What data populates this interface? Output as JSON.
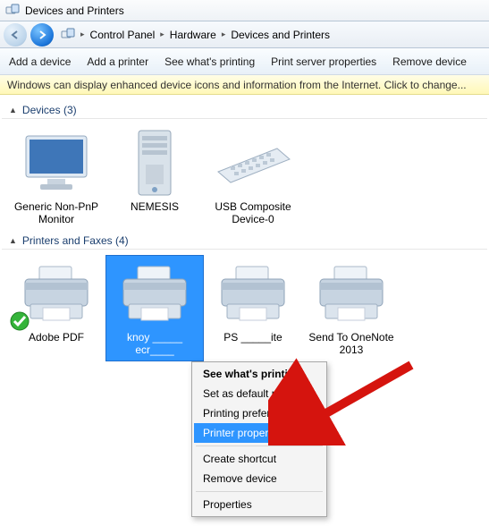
{
  "window": {
    "title": "Devices and Printers"
  },
  "breadcrumb": {
    "root_icon": "devices-printers-icon",
    "items": [
      "Control Panel",
      "Hardware",
      "Devices and Printers"
    ]
  },
  "toolbar": {
    "add_device": "Add a device",
    "add_printer": "Add a printer",
    "see_printing": "See what's printing",
    "server_props": "Print server properties",
    "remove_device": "Remove device"
  },
  "infoband": {
    "text": "Windows can display enhanced device icons and information from the Internet. Click to change..."
  },
  "sections": {
    "devices": {
      "label": "Devices",
      "count": 3,
      "items": [
        {
          "label": "Generic Non-PnP Monitor",
          "icon": "monitor"
        },
        {
          "label": "NEMESIS",
          "icon": "tower"
        },
        {
          "label": "USB Composite Device-0",
          "icon": "keyboard"
        }
      ]
    },
    "printers": {
      "label": "Printers and Faxes",
      "count": 4,
      "items": [
        {
          "label": "Adobe PDF",
          "icon": "printer",
          "default": true
        },
        {
          "label": "knoy _____ ecr____",
          "icon": "printer",
          "selected": true
        },
        {
          "label": "PS _____ite",
          "icon": "printer"
        },
        {
          "label": "Send To OneNote 2013",
          "icon": "printer"
        }
      ]
    }
  },
  "context_menu": {
    "whats_printing": "See what's printing",
    "set_default": "Set as default printer",
    "preferences": "Printing preferences",
    "printer_props": "Printer properties",
    "create_shortcut": "Create shortcut",
    "remove_device": "Remove device",
    "properties": "Properties"
  }
}
